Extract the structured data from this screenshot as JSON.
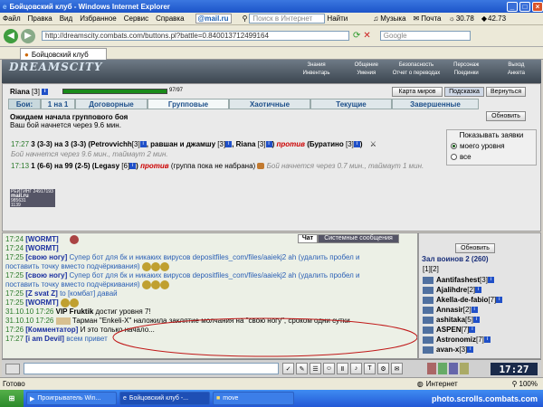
{
  "window": {
    "title": "Бойцовский клуб - Windows Internet Explorer"
  },
  "menu": {
    "items": [
      "Файл",
      "Правка",
      "Вид",
      "Избранное",
      "Сервис",
      "Справка"
    ],
    "mail_label": "@mail.ru",
    "search_placeholder": "Поиск в Интернет",
    "find_label": "Найти",
    "music_label": "Музыка",
    "mail_link": "Почта",
    "temp1": "30.78",
    "temp2": "42.73"
  },
  "address": {
    "url": "http://dreamscity.combats.com/buttons.pl?battle=0.840013712499164",
    "search_engine": "Google"
  },
  "tab": {
    "label": "Бойцовский клуб"
  },
  "game": {
    "logo": "DREAMSCITY",
    "links_top": [
      "Знания",
      "Общение",
      "Безопасность",
      "Персонаж",
      "Выход"
    ],
    "links_bottom": [
      "Инвентарь",
      "Умения",
      "Отчет о переводах",
      "Поединки",
      "Анкета"
    ]
  },
  "player": {
    "name": "Riana",
    "level": "[3]",
    "hp": "97/97",
    "hp_fraction": 1.0
  },
  "buttons": {
    "map": "Карта миров",
    "hint": "Подсказка",
    "back": "Вернуться",
    "refresh": "Обновить"
  },
  "battle_tabs": {
    "label": "Бои:",
    "items": [
      "1 на 1",
      "Договорные",
      "Групповые",
      "Хаотичные",
      "Текущие",
      "Завершенные"
    ],
    "active": 2
  },
  "waiting": {
    "title": "Ожидаем начала группового боя",
    "subtitle": "Ваш бой начнется через 9.6 мин."
  },
  "filter": {
    "title": "Показывать заявки",
    "options": [
      "моего уровня",
      "все"
    ]
  },
  "apps": [
    {
      "time": "17:27",
      "body_a": "3 (3-3) на 3 (3-3) (Petrovvichh",
      "lvl_a": "[3]",
      "body_b": ", равшан и джамшу",
      "lvl_b": "[3]",
      "body_c": ", Riana",
      "lvl_c": "[3]",
      "body_d": ")",
      "vs": "против",
      "body_e": "(Буратино",
      "lvl_e": "[3]",
      "body_f": ")",
      "note": "Бой начнется через 9.6 мин., таймаут 2 мин."
    },
    {
      "time": "17:13",
      "body_a": "1 (6-6) на 99 (2-5) (Legasy",
      "lvl_a": "[6]",
      "body_b": ")",
      "vs": "против",
      "body_e": "(группа пока не набрана)",
      "note": "Бой начнется через 0.7 мин., таймаут 1 мин."
    }
  ],
  "banner": {
    "line1": "РЕЙТИНГ 24917193",
    "line2": "mail.ru",
    "line3": "985631",
    "line4": "1139"
  },
  "chat_tabs": {
    "chat": "Чат",
    "system": "Системные сообщения"
  },
  "chat": [
    {
      "time": "17:24",
      "nick": "[WORMT]",
      "text": ""
    },
    {
      "time": "17:24",
      "nick": "[WORMT]",
      "text": ""
    },
    {
      "time": "17:25",
      "nick": "[свою ногу]",
      "text": "Супер бот для бк и никаких вирусов depositfiles_com/files/aaiekj2 ah (удалить пробел и"
    },
    {
      "time": "",
      "nick": "",
      "text": "поставить точку вместо подчёркивания)"
    },
    {
      "time": "17:25",
      "nick": "[свою ногу]",
      "text": "Супер бот для бк и никаких вирусов depositfiles_com/files/aaiekj2 ah (удалить пробел и"
    },
    {
      "time": "",
      "nick": "",
      "text": "поставить точку вместо подчёркивания)"
    },
    {
      "time": "17:25",
      "nick": "[Z svat Z]",
      "text": "to [комбат] давай"
    },
    {
      "time": "17:25",
      "nick": "[WORMT]",
      "text": ""
    },
    {
      "time": "31.10.10 17:26",
      "nick": "VIP Fruktik",
      "text": "достиг уровня 7!"
    },
    {
      "time": "31.10.10 17:26",
      "nick": "",
      "text": "Тарман \"Enkeli-X\" наложила заклятие молчания на \"свою ногу\", сроком одни сутки"
    },
    {
      "time": "17:26",
      "nick": "[Комментатор]",
      "text": "И это только начало..."
    },
    {
      "time": "17:27",
      "nick": "[i am Devil]",
      "text": "всем привет"
    }
  ],
  "side": {
    "refresh": "Обновить",
    "header": "Зал воинов 2 (260)",
    "pages": "[1][2]",
    "players": [
      {
        "name": "Aantifashest",
        "lvl": "[3]"
      },
      {
        "name": "Ajalihdre",
        "lvl": "[2]"
      },
      {
        "name": "Akella-de-fabio",
        "lvl": "[7]"
      },
      {
        "name": "Annasir",
        "lvl": "[2]"
      },
      {
        "name": "ashitaka",
        "lvl": "[5]"
      },
      {
        "name": "ASPEN",
        "lvl": "[7]"
      },
      {
        "name": "Astronomiz",
        "lvl": "[7]"
      },
      {
        "name": "avan-x",
        "lvl": "[3]"
      }
    ]
  },
  "clock": "17:27",
  "status": {
    "left": "Готово",
    "zone": "Интернет",
    "zoom": "100%"
  },
  "taskbar": {
    "items": [
      "Проигрыватель Win...",
      "Бойцовский клуб -...",
      "move"
    ],
    "watermark": "photo.scrolls.combats.com"
  }
}
